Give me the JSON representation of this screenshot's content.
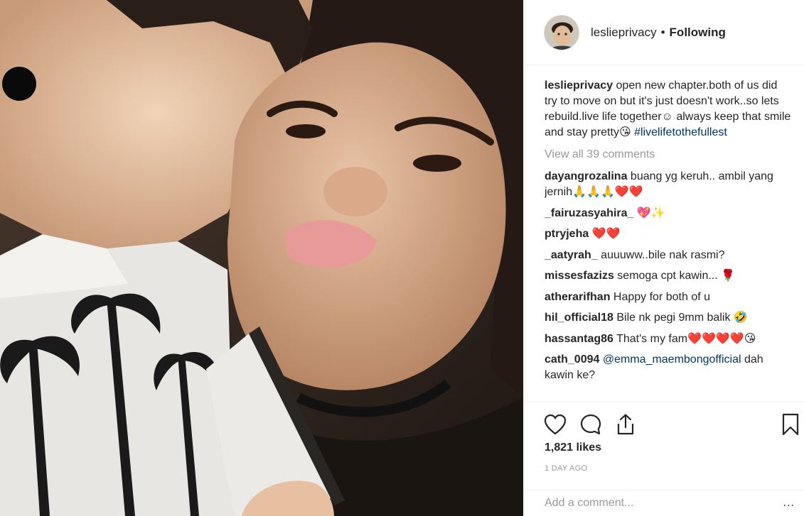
{
  "post": {
    "image_description_icon": "photo-icon"
  },
  "header": {
    "username": "leslieprivacy",
    "separator": "•",
    "follow_state": "Following"
  },
  "caption": {
    "username": "leslieprivacy",
    "text": " open new chapter.both of us did try to move on but it's just doesn't work..so lets rebuild.live life together☺ always keep that smile and stay pretty😘 ",
    "hashtag": "#livelifetothefullest"
  },
  "view_all": "View all 39 comments",
  "comments": [
    {
      "username": "dayangrozalina",
      "text": " buang yg keruh.. ambil yang jernih🙏🙏🙏❤️❤️"
    },
    {
      "username": "_fairuzasyahira_",
      "text": " 💖✨"
    },
    {
      "username": "ptryjeha",
      "text": " ❤️❤️"
    },
    {
      "username": "_aatyrah_",
      "text": " auuuww..bile nak rasmi?"
    },
    {
      "username": "missesfazizs",
      "text": " semoga cpt kawin... 🌹"
    },
    {
      "username": "atherarifhan",
      "text": " Happy for both of u"
    },
    {
      "username": "hil_official18",
      "text": " Bile nk pegi 9mm balik 🤣"
    },
    {
      "username": "hassantag86",
      "text": " That's my fam❤️❤️❤️❤️😘"
    },
    {
      "username": "cath_0094",
      "mention": "@emma_maembongofficial",
      "text": " dah kawin ke?"
    }
  ],
  "actions": {
    "like_icon": "heart-icon",
    "comment_icon": "comment-icon",
    "share_icon": "share-icon",
    "save_icon": "bookmark-icon"
  },
  "likes": "1,821 likes",
  "time": "1 DAY AGO",
  "add_comment": {
    "placeholder": "Add a comment...",
    "more": "..."
  }
}
